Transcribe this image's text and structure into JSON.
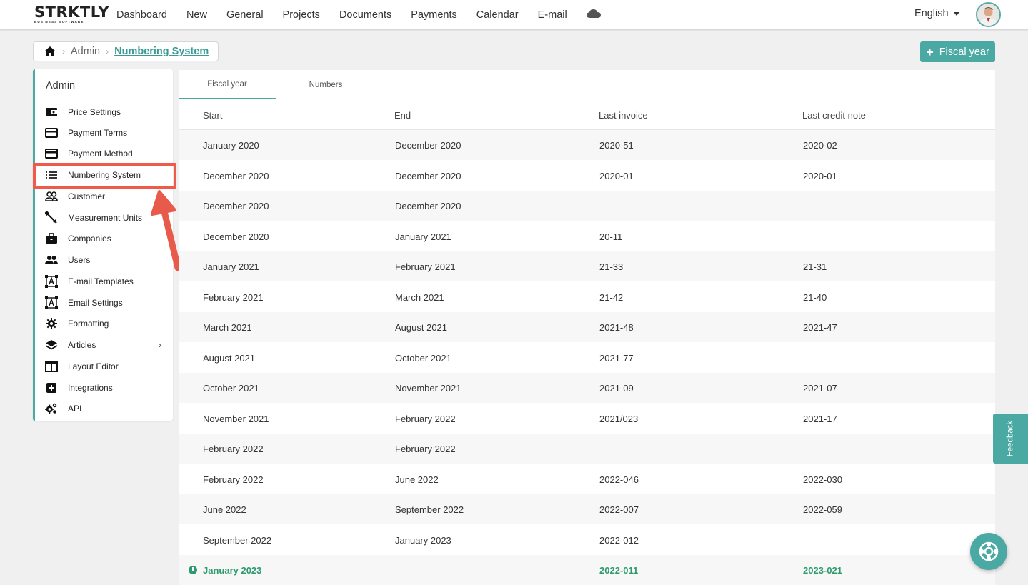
{
  "brand": {
    "name": "STRKTLY",
    "tagline": "BUSINESS SOFTWARE"
  },
  "nav": {
    "items": [
      "Dashboard",
      "New",
      "General",
      "Projects",
      "Documents",
      "Payments",
      "Calendar",
      "E-mail"
    ],
    "language": "English"
  },
  "breadcrumb": {
    "section": "Admin",
    "current": "Numbering System"
  },
  "actions": {
    "add_fiscal_year": "Fiscal year"
  },
  "sidebar": {
    "title": "Admin",
    "items": [
      {
        "label": "Price Settings",
        "icon": "wallet-icon"
      },
      {
        "label": "Payment Terms",
        "icon": "credit-card-icon"
      },
      {
        "label": "Payment Method",
        "icon": "credit-card-icon"
      },
      {
        "label": "Numbering System",
        "icon": "list-icon"
      },
      {
        "label": "Customer",
        "icon": "people-outline-icon"
      },
      {
        "label": "Measurement Units",
        "icon": "measure-icon"
      },
      {
        "label": "Companies",
        "icon": "briefcase-icon"
      },
      {
        "label": "Users",
        "icon": "users-icon"
      },
      {
        "label": "E-mail Templates",
        "icon": "text-frame-icon"
      },
      {
        "label": "Email Settings",
        "icon": "text-frame-icon"
      },
      {
        "label": "Formatting",
        "icon": "gear-icon"
      },
      {
        "label": "Articles",
        "icon": "layers-icon"
      },
      {
        "label": "Layout Editor",
        "icon": "layout-icon"
      },
      {
        "label": "Integrations",
        "icon": "plus-box-icon"
      },
      {
        "label": "API",
        "icon": "gears-icon"
      }
    ]
  },
  "tabs": [
    "Fiscal year",
    "Numbers"
  ],
  "table": {
    "columns": [
      "Start",
      "End",
      "Last invoice",
      "Last credit note"
    ],
    "rows": [
      [
        "January 2020",
        "December 2020",
        "2020-51",
        "2020-02"
      ],
      [
        "December 2020",
        "December 2020",
        "2020-01",
        "2020-01"
      ],
      [
        "December 2020",
        "December 2020",
        "",
        ""
      ],
      [
        "December 2020",
        "January 2021",
        "20-11",
        ""
      ],
      [
        "January 2021",
        "February 2021",
        "21-33",
        "21-31"
      ],
      [
        "February 2021",
        "March 2021",
        "21-42",
        "21-40"
      ],
      [
        "March 2021",
        "August 2021",
        "2021-48",
        "2021-47"
      ],
      [
        "August 2021",
        "October 2021",
        "2021-77",
        ""
      ],
      [
        "October 2021",
        "November 2021",
        "2021-09",
        "2021-07"
      ],
      [
        "November 2021",
        "February 2022",
        "2021/023",
        "2021-17"
      ],
      [
        "February 2022",
        "February 2022",
        "",
        ""
      ],
      [
        "February 2022",
        "June 2022",
        "2022-046",
        "2022-030"
      ],
      [
        "June 2022",
        "September 2022",
        "2022-007",
        "2022-059"
      ],
      [
        "September 2022",
        "January 2023",
        "2022-012",
        ""
      ],
      [
        "January 2023",
        "",
        "2022-011",
        "2023-021"
      ]
    ]
  },
  "feedback": "Feedback",
  "colors": {
    "accent": "#4aa9a3",
    "current": "#2e9b6f",
    "highlight": "#f05a4b"
  }
}
